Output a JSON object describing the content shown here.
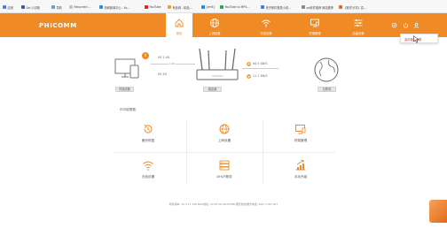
{
  "bookmarks": [
    {
      "label": "应用",
      "color": "#4a7fd1"
    },
    {
      "label": "Sai 小清新",
      "color": "#3b5998"
    },
    {
      "label": "导航",
      "color": "#5a9fd8"
    },
    {
      "label": "Recorded ...",
      "color": "#b7c9e3"
    },
    {
      "label": "浙网新闻中心 - Yo...",
      "color": "#1a8fe3"
    },
    {
      "label": "YouTube",
      "color": "#e62117"
    },
    {
      "label": "有品网 - 精品...",
      "color": "#f0a030"
    },
    {
      "label": "[zmlt]",
      "color": "#1a8fe3"
    },
    {
      "label": "YouTube to MP4...",
      "color": "#2aa34a"
    },
    {
      "label": "电子邮件登录小说...",
      "color": "#3e7de0"
    },
    {
      "label": "oe软件推荐 网站推荐",
      "color": "#888888"
    },
    {
      "label": "【软件分享】高...",
      "color": "#e26a1c"
    }
  ],
  "header": {
    "logo": "PHICOMM",
    "accent": "#f08a24",
    "nav": [
      {
        "label": "首页",
        "icon": "home-icon",
        "active": true
      },
      {
        "label": "上网设置",
        "icon": "globe-icon",
        "active": false
      },
      {
        "label": "无线设置",
        "icon": "wifi-icon",
        "active": false
      },
      {
        "label": "终端管理",
        "icon": "monitor-icon",
        "active": false
      },
      {
        "label": "高级设置",
        "icon": "sliders-icon",
        "active": false
      }
    ]
  },
  "dropdown": {
    "item": "斐讯路由管理"
  },
  "topology": {
    "terminal_label": "终端设备",
    "router_label": "路由器",
    "internet_label": "互联网",
    "band_24": "00 2.4G",
    "band_5": "00 5G",
    "wan": "LAN",
    "upload": "44.5 KB/S",
    "download": "11.7 KB/S",
    "terminal_count": "0"
  },
  "section_title": "你可能需要:",
  "tiles": [
    {
      "label": "备份恢复",
      "icon": "restore-icon"
    },
    {
      "label": "上网设置",
      "icon": "globe-icon"
    },
    {
      "label": "终端管理",
      "icon": "monitor-icon"
    },
    {
      "label": "无线设置",
      "icon": "wifi-icon"
    },
    {
      "label": "DHCP服务",
      "icon": "dhcp-icon"
    },
    {
      "label": "手动升级",
      "icon": "upgrade-icon"
    }
  ],
  "footer": "软件版本: 22.3.17.148    MAC地址: CC:07:DA:69:E9:B8    服务热线/服务电话: 400-7-167-167"
}
